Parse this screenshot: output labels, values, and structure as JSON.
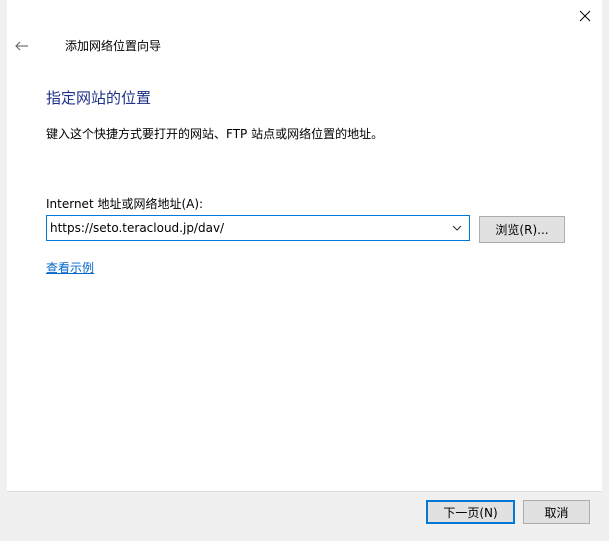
{
  "window": {
    "close_icon": "close-icon"
  },
  "header": {
    "back_icon": "back-arrow-icon",
    "wizard_title": "添加网络位置向导"
  },
  "main": {
    "heading": "指定网站的位置",
    "description": "键入这个快捷方式要打开的网站、FTP 站点或网络位置的地址。",
    "address_label": "Internet 地址或网络地址(A):",
    "address_value": "https://seto.teracloud.jp/dav/",
    "dropdown_icon": "chevron-down-icon",
    "browse_label": "浏览(R)...",
    "example_link": "查看示例"
  },
  "footer": {
    "next_label": "下一页(N)",
    "cancel_label": "取消"
  },
  "colors": {
    "heading": "#1e3287",
    "link": "#0066cc",
    "focus": "#0078d7",
    "button_bg": "#e1e1e1",
    "button_border": "#adadad",
    "footer_bg": "#f0f0f0"
  }
}
